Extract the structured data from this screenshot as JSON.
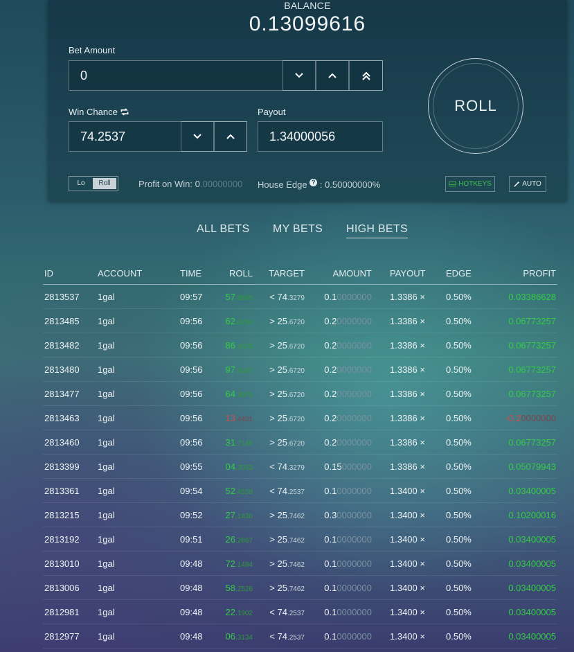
{
  "header": {
    "balance_label": "BALANCE",
    "balance_value": "0.13099616"
  },
  "bet_form": {
    "bet_amount_label": "Bet Amount",
    "bet_amount_value": "0",
    "win_chance_label": "Win Chance",
    "win_chance_value": "74.2537",
    "payout_label": "Payout",
    "payout_value": "1.34000056",
    "roll_button_label": "ROLL",
    "toggle_lo": "Lo",
    "toggle_roll": "Roll",
    "profit_label": "Profit on Win:",
    "profit_value_main": "0",
    "profit_value_dim": ".00000000",
    "house_edge_label": "House Edge",
    "house_edge_value": ": 0.50000000%",
    "hotkeys_label": "HOTKEYS",
    "auto_label": "AUTO"
  },
  "tabs": {
    "all_bets": "ALL BETS",
    "my_bets": "MY BETS",
    "high_bets": "HIGH BETS"
  },
  "table": {
    "columns": [
      "ID",
      "ACCOUNT",
      "TIME",
      "ROLL",
      "TARGET",
      "AMOUNT",
      "PAYOUT",
      "EDGE",
      "PROFIT"
    ],
    "rows": [
      {
        "id": "2813537",
        "account": "1gal",
        "time": "09:57",
        "roll_main": "57",
        "roll_dim": ".8585",
        "target_main": "< 74",
        "target_dim": ".3279",
        "amount_main": "0.1",
        "amount_dim": "0000000",
        "payout": "1.3386 ×",
        "edge": "0.50%",
        "profit_main": "0.03386628",
        "profit_dim": "",
        "loss": false
      },
      {
        "id": "2813485",
        "account": "1gal",
        "time": "09:56",
        "roll_main": "62",
        "roll_dim": ".6294",
        "target_main": "> 25",
        "target_dim": ".6720",
        "amount_main": "0.2",
        "amount_dim": "0000000",
        "payout": "1.3386 ×",
        "edge": "0.50%",
        "profit_main": "0.06773257",
        "profit_dim": "",
        "loss": false
      },
      {
        "id": "2813482",
        "account": "1gal",
        "time": "09:56",
        "roll_main": "86",
        "roll_dim": ".5429",
        "target_main": "> 25",
        "target_dim": ".6720",
        "amount_main": "0.2",
        "amount_dim": "0000000",
        "payout": "1.3386 ×",
        "edge": "0.50%",
        "profit_main": "0.06773257",
        "profit_dim": "",
        "loss": false
      },
      {
        "id": "2813480",
        "account": "1gal",
        "time": "09:56",
        "roll_main": "97",
        "roll_dim": ".6437",
        "target_main": "> 25",
        "target_dim": ".6720",
        "amount_main": "0.2",
        "amount_dim": "0000000",
        "payout": "1.3386 ×",
        "edge": "0.50%",
        "profit_main": "0.06773257",
        "profit_dim": "",
        "loss": false
      },
      {
        "id": "2813477",
        "account": "1gal",
        "time": "09:56",
        "roll_main": "64",
        "roll_dim": ".3970",
        "target_main": "> 25",
        "target_dim": ".6720",
        "amount_main": "0.2",
        "amount_dim": "0000000",
        "payout": "1.3386 ×",
        "edge": "0.50%",
        "profit_main": "0.06773257",
        "profit_dim": "",
        "loss": false
      },
      {
        "id": "2813463",
        "account": "1gal",
        "time": "09:56",
        "roll_main": "13",
        "roll_dim": ".4401",
        "target_main": "> 25",
        "target_dim": ".6720",
        "amount_main": "0.2",
        "amount_dim": "0000000",
        "payout": "1.3386 ×",
        "edge": "0.50%",
        "profit_main": "-0.2",
        "profit_dim": "0000000",
        "loss": true
      },
      {
        "id": "2813460",
        "account": "1gal",
        "time": "09:56",
        "roll_main": "31",
        "roll_dim": ".7148",
        "target_main": "> 25",
        "target_dim": ".6720",
        "amount_main": "0.2",
        "amount_dim": "0000000",
        "payout": "1.3386 ×",
        "edge": "0.50%",
        "profit_main": "0.06773257",
        "profit_dim": "",
        "loss": false
      },
      {
        "id": "2813399",
        "account": "1gal",
        "time": "09:55",
        "roll_main": "04",
        "roll_dim": ".3053",
        "target_main": "< 74",
        "target_dim": ".3279",
        "amount_main": "0.15",
        "amount_dim": "000000",
        "payout": "1.3386 ×",
        "edge": "0.50%",
        "profit_main": "0.05079943",
        "profit_dim": "",
        "loss": false
      },
      {
        "id": "2813361",
        "account": "1gal",
        "time": "09:54",
        "roll_main": "52",
        "roll_dim": ".4559",
        "target_main": "< 74",
        "target_dim": ".2537",
        "amount_main": "0.1",
        "amount_dim": "0000000",
        "payout": "1.3400 ×",
        "edge": "0.50%",
        "profit_main": "0.03400005",
        "profit_dim": "",
        "loss": false
      },
      {
        "id": "2813215",
        "account": "1gal",
        "time": "09:52",
        "roll_main": "27",
        "roll_dim": ".1430",
        "target_main": "> 25",
        "target_dim": ".7462",
        "amount_main": "0.3",
        "amount_dim": "0000000",
        "payout": "1.3400 ×",
        "edge": "0.50%",
        "profit_main": "0.10200016",
        "profit_dim": "",
        "loss": false
      },
      {
        "id": "2813192",
        "account": "1gal",
        "time": "09:51",
        "roll_main": "26",
        "roll_dim": ".2867",
        "target_main": "> 25",
        "target_dim": ".7462",
        "amount_main": "0.1",
        "amount_dim": "0000000",
        "payout": "1.3400 ×",
        "edge": "0.50%",
        "profit_main": "0.03400005",
        "profit_dim": "",
        "loss": false
      },
      {
        "id": "2813010",
        "account": "1gal",
        "time": "09:48",
        "roll_main": "72",
        "roll_dim": ".1484",
        "target_main": "> 25",
        "target_dim": ".7462",
        "amount_main": "0.1",
        "amount_dim": "0000000",
        "payout": "1.3400 ×",
        "edge": "0.50%",
        "profit_main": "0.03400005",
        "profit_dim": "",
        "loss": false
      },
      {
        "id": "2813006",
        "account": "1gal",
        "time": "09:48",
        "roll_main": "58",
        "roll_dim": ".2526",
        "target_main": "> 25",
        "target_dim": ".7462",
        "amount_main": "0.1",
        "amount_dim": "0000000",
        "payout": "1.3400 ×",
        "edge": "0.50%",
        "profit_main": "0.03400005",
        "profit_dim": "",
        "loss": false
      },
      {
        "id": "2812981",
        "account": "1gal",
        "time": "09:48",
        "roll_main": "22",
        "roll_dim": ".1902",
        "target_main": "< 74",
        "target_dim": ".2537",
        "amount_main": "0.1",
        "amount_dim": "0000000",
        "payout": "1.3400 ×",
        "edge": "0.50%",
        "profit_main": "0.03400005",
        "profit_dim": "",
        "loss": false
      },
      {
        "id": "2812977",
        "account": "1gal",
        "time": "09:48",
        "roll_main": "06",
        "roll_dim": ".3134",
        "target_main": "< 74",
        "target_dim": ".2537",
        "amount_main": "0.1",
        "amount_dim": "0000000",
        "payout": "1.3400 ×",
        "edge": "0.50%",
        "profit_main": "0.03400005",
        "profit_dim": "",
        "loss": false
      }
    ]
  },
  "colors": {
    "win": "#33cc44",
    "loss": "#d24a4a",
    "panel": "#1c4352"
  }
}
